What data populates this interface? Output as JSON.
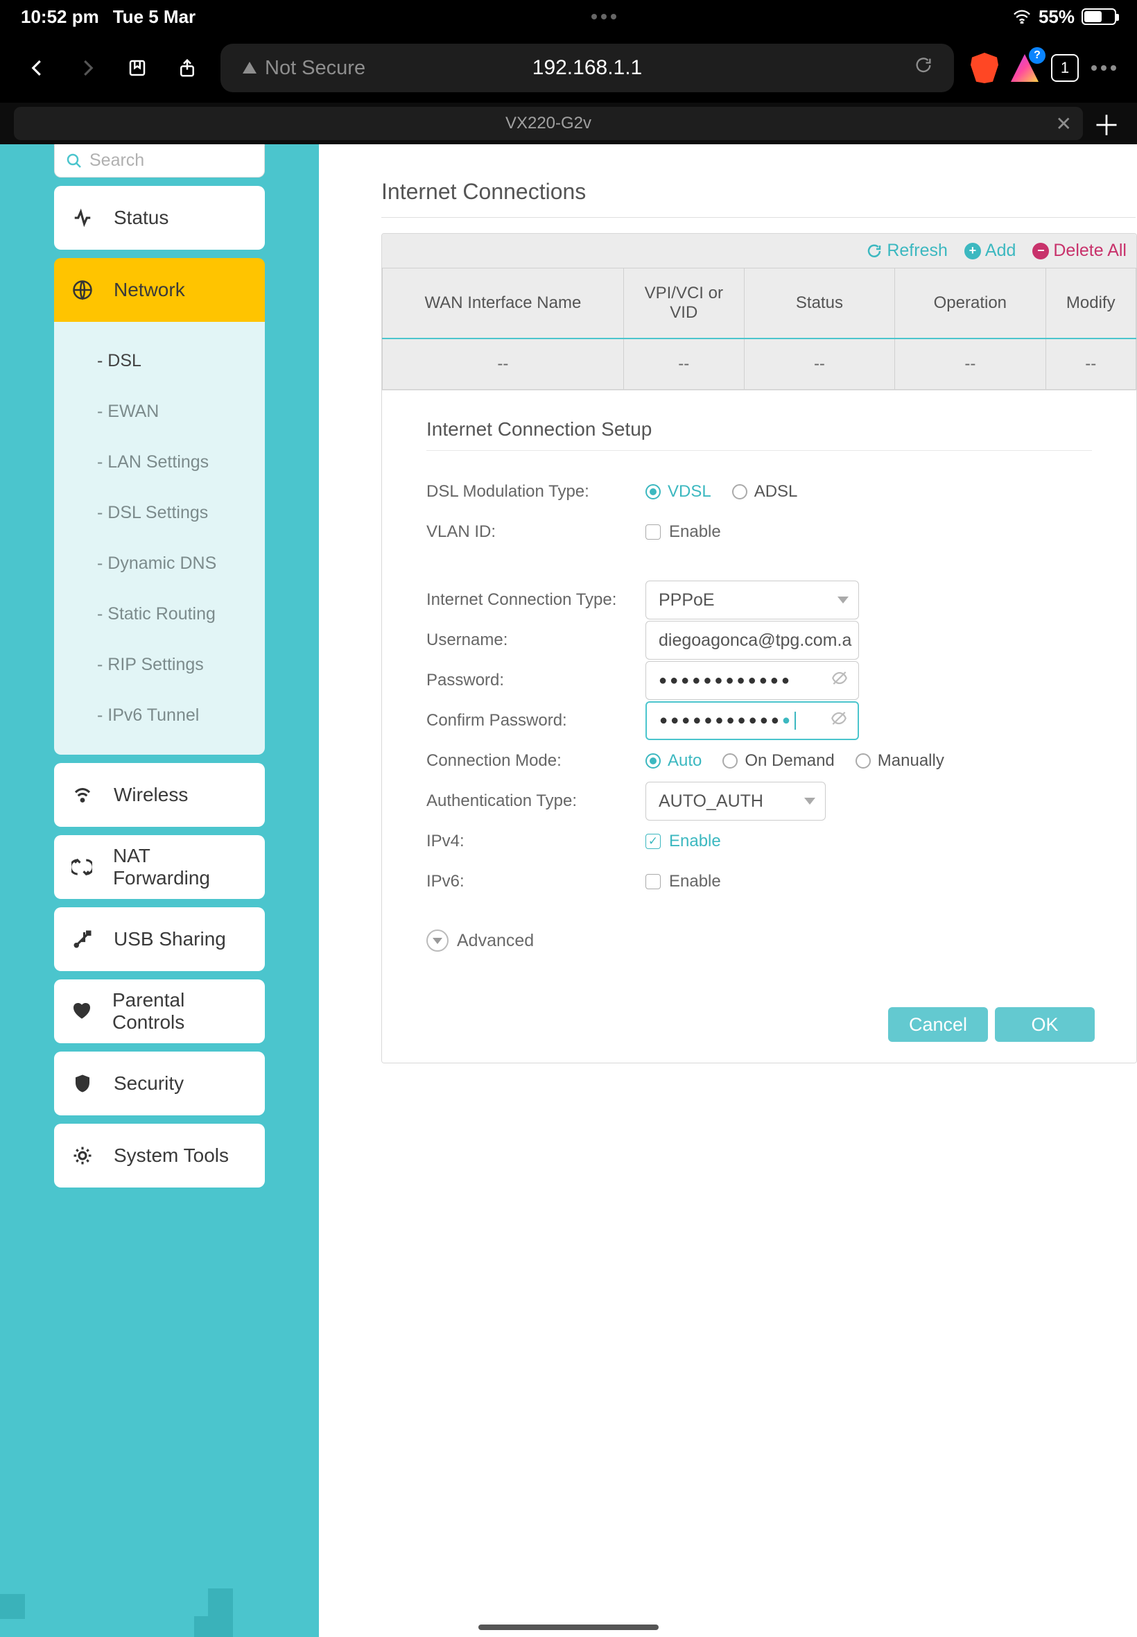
{
  "statusbar": {
    "time": "10:52 pm",
    "date": "Tue 5 Mar",
    "battery_pct": "55%",
    "battery_fill_pct": 55
  },
  "browser": {
    "not_secure": "Not Secure",
    "url": "192.168.1.1",
    "tab_count": "1",
    "tab_title": "VX220-G2v"
  },
  "sidebar": {
    "search_placeholder": "Search",
    "items": {
      "status": "Status",
      "network": "Network",
      "wireless": "Wireless",
      "nat": "NAT Forwarding",
      "usb": "USB Sharing",
      "parental": "Parental Controls",
      "security": "Security",
      "systools": "System Tools"
    },
    "network_sub": {
      "dsl": "- DSL",
      "ewan": "- EWAN",
      "lan": "- LAN Settings",
      "dslset": "- DSL Settings",
      "ddns": "- Dynamic DNS",
      "static": "- Static Routing",
      "rip": "- RIP Settings",
      "ipv6t": "- IPv6 Tunnel"
    }
  },
  "main": {
    "title": "Internet Connections",
    "actions": {
      "refresh": "Refresh",
      "add": "Add",
      "delete_all": "Delete All"
    },
    "table": {
      "headers": {
        "wan": "WAN Interface Name",
        "vpi": "VPI/VCI or VID",
        "status": "Status",
        "op": "Operation",
        "modify": "Modify"
      },
      "row": {
        "wan": "--",
        "vpi": "--",
        "status": "--",
        "op": "--",
        "modify": "--"
      }
    },
    "form": {
      "title": "Internet Connection Setup",
      "dsl_mod_label": "DSL Modulation Type:",
      "dsl_vdsl": "VDSL",
      "dsl_adsl": "ADSL",
      "vlan_label": "VLAN ID:",
      "vlan_enable": "Enable",
      "conn_type_label": "Internet Connection Type:",
      "conn_type_value": "PPPoE",
      "username_label": "Username:",
      "username_value": "diegoagonca@tpg.com.a",
      "password_label": "Password:",
      "confirm_label": "Confirm Password:",
      "conn_mode_label": "Connection Mode:",
      "cm_auto": "Auto",
      "cm_ondemand": "On Demand",
      "cm_manual": "Manually",
      "auth_label": "Authentication Type:",
      "auth_value": "AUTO_AUTH",
      "ipv4_label": "IPv4:",
      "ipv4_enable": "Enable",
      "ipv6_label": "IPv6:",
      "ipv6_enable": "Enable",
      "advanced": "Advanced",
      "cancel": "Cancel",
      "ok": "OK"
    }
  }
}
